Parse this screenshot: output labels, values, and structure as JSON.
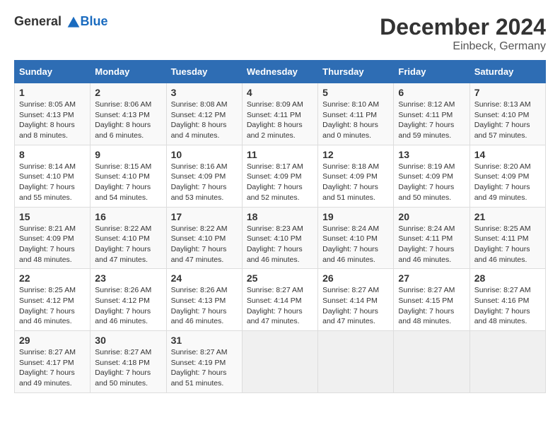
{
  "logo": {
    "general": "General",
    "blue": "Blue"
  },
  "title": "December 2024",
  "subtitle": "Einbeck, Germany",
  "headers": [
    "Sunday",
    "Monday",
    "Tuesday",
    "Wednesday",
    "Thursday",
    "Friday",
    "Saturday"
  ],
  "weeks": [
    [
      {
        "day": "1",
        "sunrise": "8:05 AM",
        "sunset": "4:13 PM",
        "daylight": "8 hours and 8 minutes."
      },
      {
        "day": "2",
        "sunrise": "8:06 AM",
        "sunset": "4:13 PM",
        "daylight": "8 hours and 6 minutes."
      },
      {
        "day": "3",
        "sunrise": "8:08 AM",
        "sunset": "4:12 PM",
        "daylight": "8 hours and 4 minutes."
      },
      {
        "day": "4",
        "sunrise": "8:09 AM",
        "sunset": "4:11 PM",
        "daylight": "8 hours and 2 minutes."
      },
      {
        "day": "5",
        "sunrise": "8:10 AM",
        "sunset": "4:11 PM",
        "daylight": "8 hours and 0 minutes."
      },
      {
        "day": "6",
        "sunrise": "8:12 AM",
        "sunset": "4:11 PM",
        "daylight": "7 hours and 59 minutes."
      },
      {
        "day": "7",
        "sunrise": "8:13 AM",
        "sunset": "4:10 PM",
        "daylight": "7 hours and 57 minutes."
      }
    ],
    [
      {
        "day": "8",
        "sunrise": "8:14 AM",
        "sunset": "4:10 PM",
        "daylight": "7 hours and 55 minutes."
      },
      {
        "day": "9",
        "sunrise": "8:15 AM",
        "sunset": "4:10 PM",
        "daylight": "7 hours and 54 minutes."
      },
      {
        "day": "10",
        "sunrise": "8:16 AM",
        "sunset": "4:09 PM",
        "daylight": "7 hours and 53 minutes."
      },
      {
        "day": "11",
        "sunrise": "8:17 AM",
        "sunset": "4:09 PM",
        "daylight": "7 hours and 52 minutes."
      },
      {
        "day": "12",
        "sunrise": "8:18 AM",
        "sunset": "4:09 PM",
        "daylight": "7 hours and 51 minutes."
      },
      {
        "day": "13",
        "sunrise": "8:19 AM",
        "sunset": "4:09 PM",
        "daylight": "7 hours and 50 minutes."
      },
      {
        "day": "14",
        "sunrise": "8:20 AM",
        "sunset": "4:09 PM",
        "daylight": "7 hours and 49 minutes."
      }
    ],
    [
      {
        "day": "15",
        "sunrise": "8:21 AM",
        "sunset": "4:09 PM",
        "daylight": "7 hours and 48 minutes."
      },
      {
        "day": "16",
        "sunrise": "8:22 AM",
        "sunset": "4:10 PM",
        "daylight": "7 hours and 47 minutes."
      },
      {
        "day": "17",
        "sunrise": "8:22 AM",
        "sunset": "4:10 PM",
        "daylight": "7 hours and 47 minutes."
      },
      {
        "day": "18",
        "sunrise": "8:23 AM",
        "sunset": "4:10 PM",
        "daylight": "7 hours and 46 minutes."
      },
      {
        "day": "19",
        "sunrise": "8:24 AM",
        "sunset": "4:10 PM",
        "daylight": "7 hours and 46 minutes."
      },
      {
        "day": "20",
        "sunrise": "8:24 AM",
        "sunset": "4:11 PM",
        "daylight": "7 hours and 46 minutes."
      },
      {
        "day": "21",
        "sunrise": "8:25 AM",
        "sunset": "4:11 PM",
        "daylight": "7 hours and 46 minutes."
      }
    ],
    [
      {
        "day": "22",
        "sunrise": "8:25 AM",
        "sunset": "4:12 PM",
        "daylight": "7 hours and 46 minutes."
      },
      {
        "day": "23",
        "sunrise": "8:26 AM",
        "sunset": "4:12 PM",
        "daylight": "7 hours and 46 minutes."
      },
      {
        "day": "24",
        "sunrise": "8:26 AM",
        "sunset": "4:13 PM",
        "daylight": "7 hours and 46 minutes."
      },
      {
        "day": "25",
        "sunrise": "8:27 AM",
        "sunset": "4:14 PM",
        "daylight": "7 hours and 47 minutes."
      },
      {
        "day": "26",
        "sunrise": "8:27 AM",
        "sunset": "4:14 PM",
        "daylight": "7 hours and 47 minutes."
      },
      {
        "day": "27",
        "sunrise": "8:27 AM",
        "sunset": "4:15 PM",
        "daylight": "7 hours and 48 minutes."
      },
      {
        "day": "28",
        "sunrise": "8:27 AM",
        "sunset": "4:16 PM",
        "daylight": "7 hours and 48 minutes."
      }
    ],
    [
      {
        "day": "29",
        "sunrise": "8:27 AM",
        "sunset": "4:17 PM",
        "daylight": "7 hours and 49 minutes."
      },
      {
        "day": "30",
        "sunrise": "8:27 AM",
        "sunset": "4:18 PM",
        "daylight": "7 hours and 50 minutes."
      },
      {
        "day": "31",
        "sunrise": "8:27 AM",
        "sunset": "4:19 PM",
        "daylight": "7 hours and 51 minutes."
      },
      null,
      null,
      null,
      null
    ]
  ]
}
